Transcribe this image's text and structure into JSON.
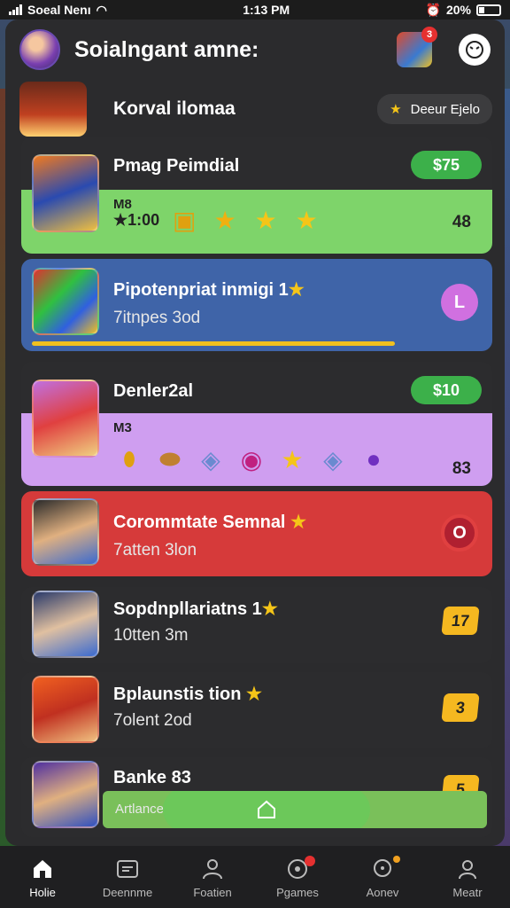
{
  "status": {
    "carrier": "Soeal Nenı",
    "time": "1:13 PM",
    "battery": "20%"
  },
  "header": {
    "title": "Soialngant amne:",
    "notif_count": "3"
  },
  "top_row": {
    "name": "Korval ilomaa",
    "pill_label": "Deeur Ejelo"
  },
  "cards": [
    {
      "title": "Pmag Peimdial",
      "badge": "$75",
      "level": "M8",
      "sub": "1:00",
      "count": "48",
      "bg": "#7ed46a"
    },
    {
      "title": "Pipotenpriat inmigi 1",
      "sub": "7itnpes 3od",
      "badge_letter": "L",
      "bg": "#3f64a8"
    },
    {
      "title": "Denler2al",
      "badge": "$10",
      "level": "M3",
      "count": "83",
      "bg": "#cf9ef0"
    },
    {
      "title": "Corommtate Semnal",
      "sub": "7atten 3lon",
      "bg": "#d63a3a"
    },
    {
      "title": "Sopdnpllariatns 1",
      "sub": "10tten 3m",
      "badge": "17",
      "bg": "#2c2c2e"
    },
    {
      "title": "Bplaunstis tion",
      "sub": "7olent 2od",
      "badge": "3",
      "bg": "#2c2c2e"
    },
    {
      "title": "Banke 83",
      "badge": "5",
      "bg": "#2c2c2e"
    }
  ],
  "bottom_pill": {
    "label": "Artlance"
  },
  "tabs": [
    {
      "label": "Holie"
    },
    {
      "label": "Deennme"
    },
    {
      "label": "Foatien"
    },
    {
      "label": "Pgames"
    },
    {
      "label": "Aonev"
    },
    {
      "label": "Meatr"
    }
  ],
  "colors": {
    "green": "#3cb04a",
    "gold": "#f5c518",
    "accent_purple": "#cf9ef0",
    "accent_red": "#d63a3a"
  }
}
